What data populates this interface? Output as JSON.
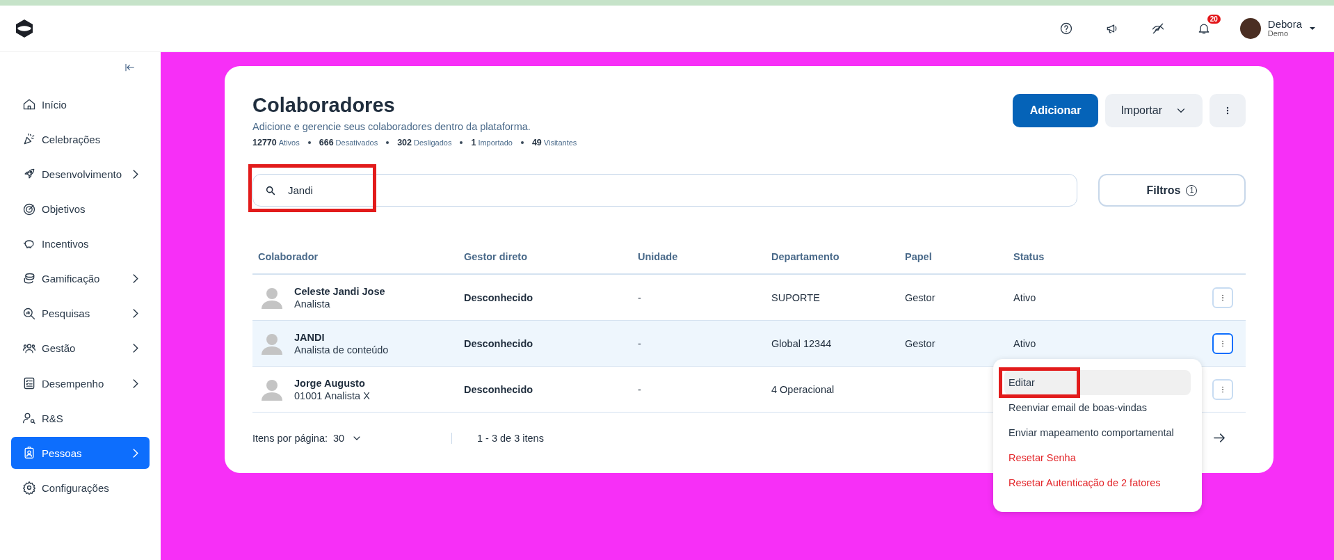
{
  "top_bar": {
    "notification_count": "20",
    "user": {
      "name": "Debora",
      "subtitle": "Demo"
    }
  },
  "sidebar": {
    "items": [
      {
        "label": "Início",
        "expandable": false,
        "selected": false
      },
      {
        "label": "Celebrações",
        "expandable": false,
        "selected": false
      },
      {
        "label": "Desenvolvimento",
        "expandable": true,
        "selected": false
      },
      {
        "label": "Objetivos",
        "expandable": false,
        "selected": false
      },
      {
        "label": "Incentivos",
        "expandable": false,
        "selected": false
      },
      {
        "label": "Gamificação",
        "expandable": true,
        "selected": false
      },
      {
        "label": "Pesquisas",
        "expandable": true,
        "selected": false
      },
      {
        "label": "Gestão",
        "expandable": true,
        "selected": false
      },
      {
        "label": "Desempenho",
        "expandable": true,
        "selected": false
      },
      {
        "label": "R&S",
        "expandable": false,
        "selected": false
      },
      {
        "label": "Pessoas",
        "expandable": true,
        "selected": true
      },
      {
        "label": "Configurações",
        "expandable": false,
        "selected": false
      }
    ]
  },
  "page": {
    "title": "Colaboradores",
    "subtitle": "Adicione e gerencie seus colaboradores dentro da plataforma.",
    "stats": [
      {
        "value": "12770",
        "label": "Ativos"
      },
      {
        "value": "666",
        "label": "Desativados"
      },
      {
        "value": "302",
        "label": "Desligados"
      },
      {
        "value": "1",
        "label": "Importado"
      },
      {
        "value": "49",
        "label": "Visitantes"
      }
    ],
    "add_button": "Adicionar",
    "import_button": "Importar",
    "search": {
      "value": "Jandi",
      "annotated": true
    },
    "filters": {
      "label": "Filtros",
      "count": "1"
    }
  },
  "table": {
    "columns": [
      "Colaborador",
      "Gestor direto",
      "Unidade",
      "Departamento",
      "Papel",
      "Status"
    ],
    "rows": [
      {
        "name": "Celeste Jandi Jose",
        "role": "Analista",
        "manager": "Desconhecido",
        "unit": "-",
        "department": "SUPORTE",
        "papel": "Gestor",
        "status": "Ativo",
        "selected": false
      },
      {
        "name": "JANDI",
        "role": "Analista de conteúdo",
        "manager": "Desconhecido",
        "unit": "-",
        "department": "Global 12344",
        "papel": "Gestor",
        "status": "Ativo",
        "selected": true
      },
      {
        "name": "Jorge Augusto",
        "role": "01001 Analista X",
        "manager": "Desconhecido",
        "unit": "-",
        "department": "4 Operacional",
        "selected": false
      }
    ]
  },
  "pagination": {
    "per_page_label": "Itens por página:",
    "per_page": "30",
    "range": "1 - 3 de 3 itens"
  },
  "row_menu": {
    "items": [
      {
        "label": "Editar",
        "kind": "normal",
        "selected": true,
        "annotated": true
      },
      {
        "label": "Reenviar email de boas-vindas",
        "kind": "normal",
        "selected": false,
        "annotated": false
      },
      {
        "label": "Enviar mapeamento comportamental",
        "kind": "normal",
        "selected": false,
        "annotated": false
      },
      {
        "label": "Resetar Senha",
        "kind": "danger",
        "selected": false,
        "annotated": false
      },
      {
        "label": "Resetar Autenticação de 2 fatores",
        "kind": "danger",
        "selected": false,
        "annotated": false
      }
    ]
  }
}
